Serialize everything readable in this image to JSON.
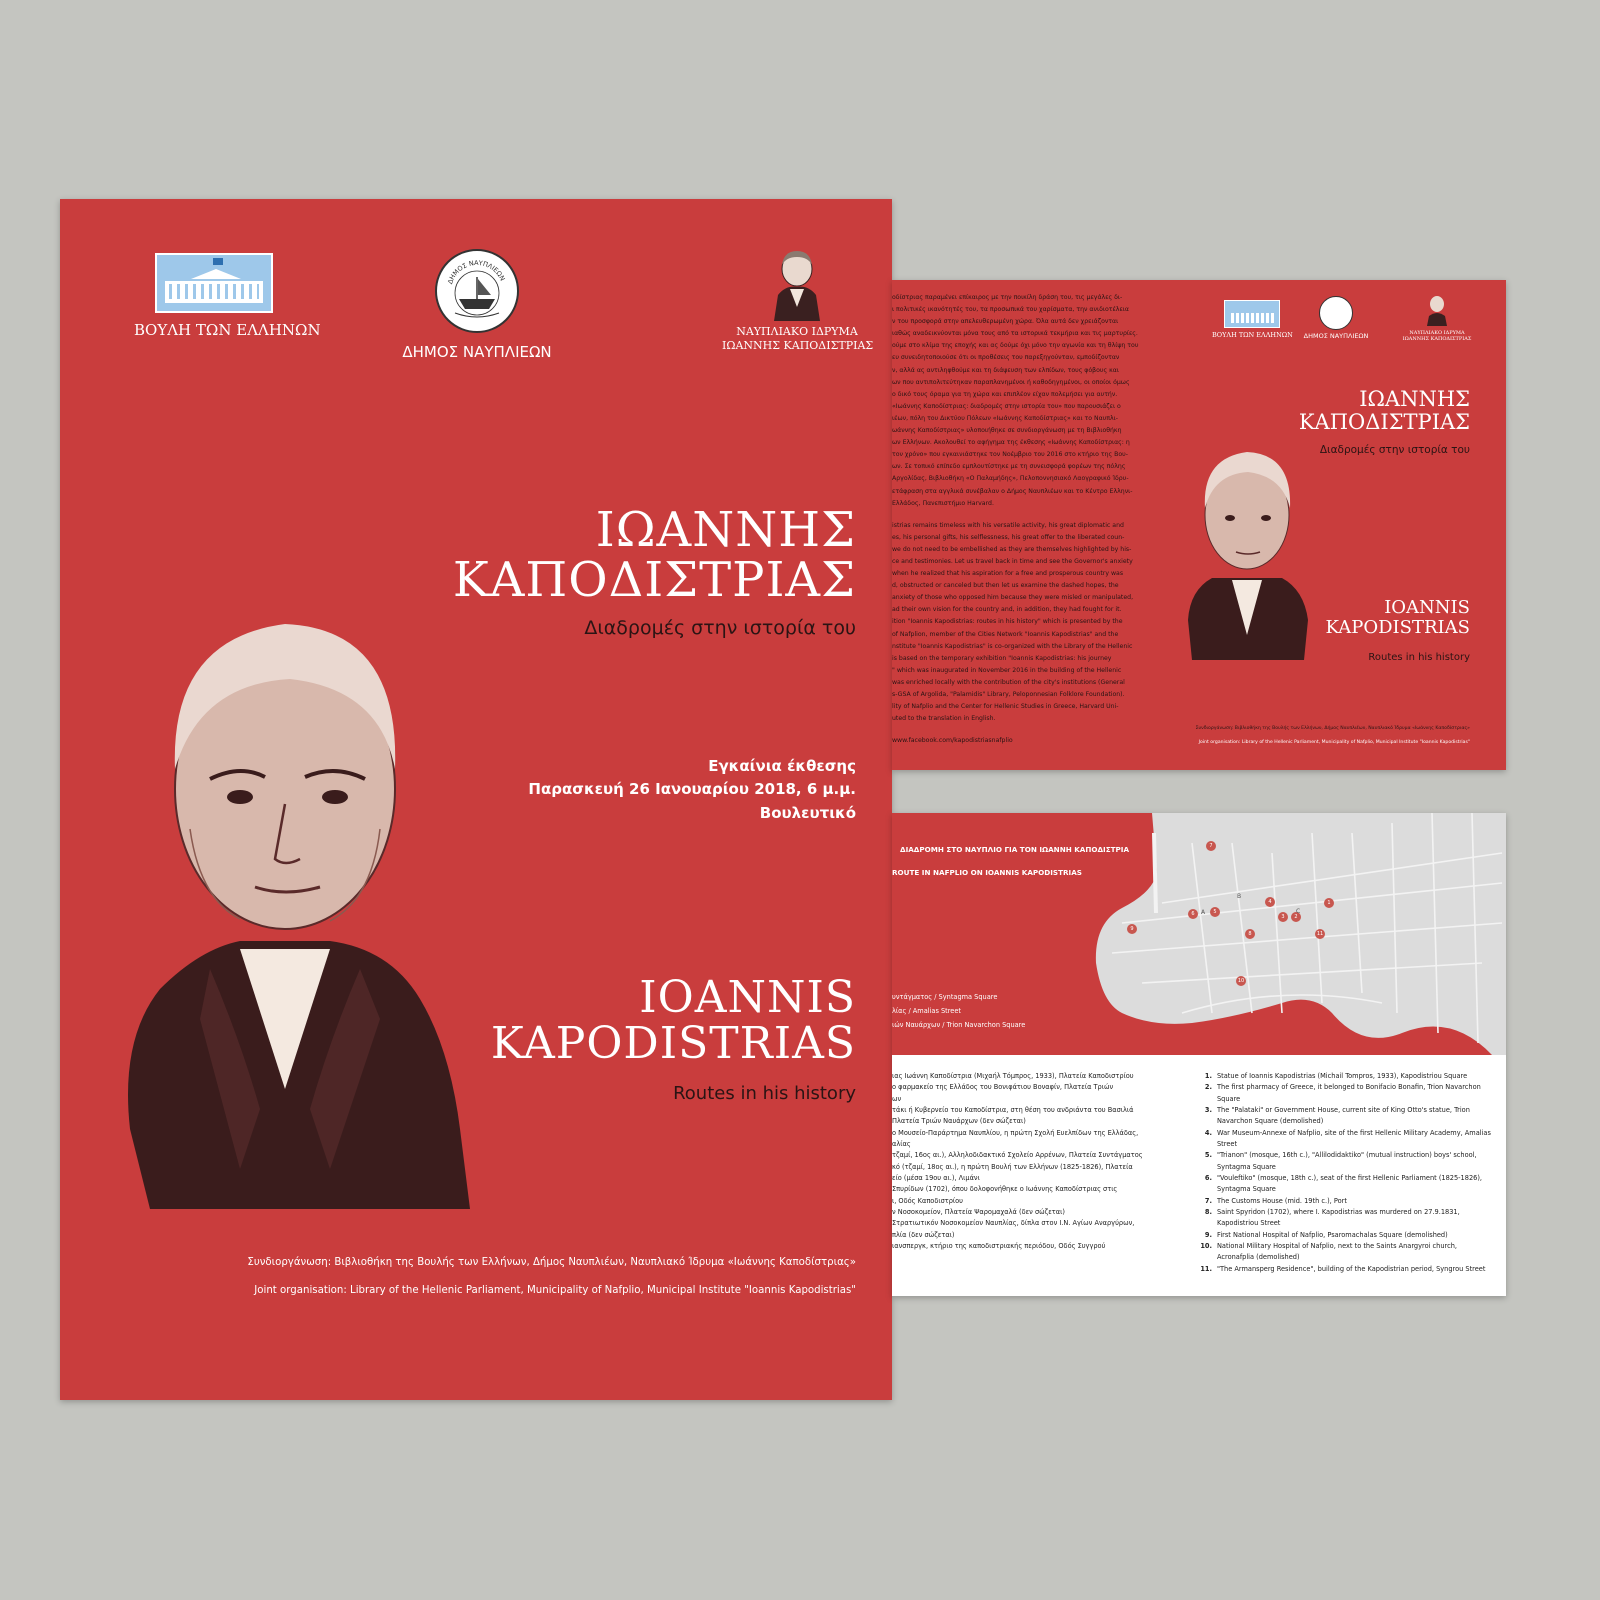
{
  "poster": {
    "logos": {
      "parliament": "ΒΟΥΛΗ ΤΩΝ ΕΛΛΗΝΩΝ",
      "municipality": "ΔΗΜΟΣ ΝΑΥΠΛΙΕΩΝ",
      "municipality_seal": "ΔΗΜΟΣ ΝΑΥΠΛΙΕΩΝ",
      "institute_line1": "ΝΑΥΠΛΙΑΚΟ ΙΔΡΥΜΑ",
      "institute_line2": "ΙΩΑΝΝΗΣ ΚΑΠΟΔΙΣΤΡΙΑΣ"
    },
    "title_gr_line1": "ΙΩΑΝΝΗΣ",
    "title_gr_line2": "ΚΑΠΟΔΙΣΤΡΙΑΣ",
    "subtitle_gr": "Διαδρομές στην ιστορία του",
    "event_line1": "Εγκαίνια έκθεσης",
    "event_line2": "Παρασκευή 26 Ιανουαρίου 2018, 6 μ.μ.",
    "event_line3": "Βουλευτικό",
    "title_en_line1": "IOANNIS",
    "title_en_line2": "KAPODISTRIAS",
    "subtitle_en": "Routes in his history",
    "credit_gr": "Συνδιοργάνωση: Βιβλιοθήκη της Βουλής των Ελλήνων, Δήμος Ναυπλιέων, Ναυπλιακό Ίδρυμα «Ιωάννης Καποδίστριας»",
    "credit_en": "Joint organisation: Library of the Hellenic Parliament, Municipality of Nafplio, Municipal Institute \"Ioannis Kapodistrias\""
  },
  "brochure_top": {
    "text_gr": [
      "οδίστριας παραμένει επίκαιρος με την ποικίλη δράση του, τις μεγάλες δι-",
      "ι πολιτικές ικανότητές του, τα προσωπικά του χαρίσματα, την ανιδιοτέλεια",
      "ν του προσφορά στην απελευθερωμένη χώρα. Όλα αυτά δεν χρειάζονται",
      "ιαθώς αναδεικνύονται μόνα τους από τα ιστορικά τεκμήρια και τις μαρτυρίες.",
      "ούμε στο κλίμα της εποχής και ας δούμε όχι μόνο την αγωνία και τη θλίψη του",
      "ευ συνειδητοποιούσε ότι οι προθέσεις του παρεξηγούνταν, εμποδίζονταν",
      "ν, αλλά ας αντιληφθούμε και τη διάψευση των ελπίδων, τους φόβους και",
      "ων που αντιπολιτεύτηκαν παραπλανημένοι ή καθοδηγημένοι, οι οποίοι όμως",
      "ο δικό τους όραμα για τη χώρα και επιπλέον είχαν πολεμήσει για αυτήν.",
      "«Ιωάννης Καποδίστριας: διαδρομές στην ιστορία του» που παρουσιάζει ο",
      "ιέων, πόλη του Δικτύου Πόλεων «Ιωάννης Καποδίστριας» και το Ναυπλι-",
      "ωάννης Καποδίστριας» υλοποιήθηκε σε συνδιοργάνωση με τη  Βιβλιοθήκη",
      "ων Ελλήνων. Ακολουθεί το αφήγημα της έκθεσης «Ιωάννης Καποδίστριας: η",
      "τον χρόνο» που εγκαινιάστηκε τον Νοέμβριο του 2016 στο κτήριο της Βου-",
      "ων. Σε τοπικό επίπεδο εμπλουτίστηκε με τη συνεισφορά φορέων της πόλης",
      "Αργολίδας, Βιβλιοθήκη «Ο Παλαμήδης», Πελοποννησιακό Λαογραφικό Ίδρυ-",
      "ετάφραση στα αγγλικά συνέβαλαν ο Δήμος Ναυπλιέων και το Κέντρο Ελληνι-",
      "Ελλάδος, Πανεπιστήμιο Harvard."
    ],
    "text_en": [
      "istrias remains timeless with his versatile activity, his great diplomatic and",
      "es, his personal gifts, his selflessness, his great offer to the liberated coun-",
      "we do not need to be embellished as they are themselves highlighted by his-",
      "ce and testimonies. Let us travel back in time and see the Governor's anxiety",
      "when he realized that his aspiration for a free and prosperous country was",
      "d, obstructed or canceled but then let us examine the dashed hopes, the",
      "anxiety of those who opposed him because they were misled or manipulated,",
      "ad their own vision for the country and, in addition, they had fought for it.",
      "ition \"Ioannis Kapodistrias: routes in his history\" which is presented by the",
      "of Nafplion, member of the Cities Network \"Ioannis Kapodistrias\" and the",
      "nstitute \"Ioannis Kapodistrias\" is co-organized with the Library of the Hellenic",
      "is based on the temporary exhibition \"Ioannis Kapodistrias: his journey",
      "\" which was inaugurated in November 2016 in the building of the Hellenic",
      "was enriched locally with the contribution of the city's institutions (General",
      "s-GSA of Argolida, \"Palamidis\" Library, Peloponnesian Folklore Foundation).",
      "lity of Nafplio and the Center for Hellenic Studies in Greece, Harvard Uni-",
      "uted to the translation in English."
    ],
    "facebook": "www.facebook.com/kapodistriasnafplio",
    "logos": {
      "parliament": "ΒΟΥΛΗ ΤΩΝ ΕΛΛΗΝΩΝ",
      "municipality": "ΔΗΜΟΣ ΝΑΥΠΛΙΕΩΝ",
      "institute_line1": "ΝΑΥΠΛΙΑΚΟ ΙΔΡΥΜΑ",
      "institute_line2": "ΙΩΑΝΝΗΣ ΚΑΠΟΔΙΣΤΡΙΑΣ"
    },
    "title_gr_line1": "ΙΩΑΝΝΗΣ",
    "title_gr_line2": "ΚΑΠΟΔΙΣΤΡΙΑΣ",
    "subtitle_gr": "Διαδρομές στην ιστορία του",
    "title_en_line1": "IOANNIS",
    "title_en_line2": "KAPODISTRIAS",
    "subtitle_en": "Routes in his history",
    "credit_gr": "Συνδιοργάνωση: Βιβλιοθήκη της Βουλής των Ελλήνων, Δήμος Ναυπλιέων, Ναυπλιακό Ίδρυμα «Ιωάννης Καποδίστριας»",
    "credit_en": "Joint organisation: Library of the Hellenic Parliament, Municipality of Nafplio, Municipal Institute \"Ioannis Kapodistrias\""
  },
  "brochure_bottom": {
    "route_title_gr": "ΔΙΑΔΡΟΜΗ ΣΤΟ ΝΑΥΠΛΙΟ ΓΙΑ ΤΟΝ ΙΩΑΝΝΗ ΚΑΠΟΔΙΣΤΡΙΑ",
    "route_title_en": "ROUTE IN  NAFPLIO ON IOANNIS KAPODISTRIAS",
    "map_legend": [
      "υντάγματος / Syntagma Square",
      "λίας / Amalias Street",
      "ιών Ναυάρχων / Trion Navarchon Square"
    ],
    "map_markers": [
      "1",
      "2",
      "3",
      "4",
      "5",
      "6",
      "7",
      "8",
      "9",
      "10",
      "11"
    ],
    "map_letters": [
      "A",
      "B",
      "C"
    ],
    "list_gr": [
      "ιας Ιωάννη Καποδίστρια (Μιχαήλ Τόμπρος, 1933), Πλατεία Καποδιστρίου",
      "ο φαρμακείο της Ελλάδος του Βονιφάτιου Βοναφίν, Πλατεία Τριών",
      "ων",
      "τάκι ή Κυβερνείο του Καποδίστρια, στη θέση του ανδριάντα του Βασιλιά",
      "Πλατεία Τριών Ναυάρχων (δεν σώζεται)",
      "ο Μουσείο-Παράρτημα Ναυπλίου, η πρώτη Σχολή Ευελπίδων της Ελλάδας,",
      "αλίας",
      "τζαμί, 16ος αι.), Αλληλοδιδακτικό Σχολείο Αρρένων, Πλατεία Συντάγματος",
      "κό (τζαμί, 18ος αι.), η πρώτη Βουλή των Ελλήνων (1825-1826), Πλατεία",
      "",
      "είο (μέσα 19ου αι.), Λιμάνι",
      "Σπυρίδων (1702), όπου δολοφονήθηκε ο Ιωάννης Καποδίστριας στις",
      "ι, Οδός Καποδιστρίου",
      "ν Νοσοκομείον, Πλατεία Ψαρομαχαλά (δεν σώζεται)",
      "Στρατιωτικόν Νοσοκομείον Ναυπλίας, δίπλα στον Ι.Ν. Αγίων Αναργύρων,",
      "πλία (δεν σώζεται)",
      "ιανσπεργκ, κτήριο της καποδιστριακής περιόδου, Οδός Συγγρού"
    ],
    "list_en": [
      {
        "num": "1.",
        "text": "Statue of Ioannis Kapodistrias (Michail Tompros, 1933), Kapodistriou Square"
      },
      {
        "num": "2.",
        "text": "The first pharmacy of Greece, it belonged to Bonifacio Bonafin, Trion Navarchon"
      },
      {
        "num": "",
        "text": "Square"
      },
      {
        "num": "3.",
        "text": "The \"Palataki\" or Government House, current site of King Otto's statue, Trion"
      },
      {
        "num": "",
        "text": "Navarchon Square (demolished)"
      },
      {
        "num": "4.",
        "text": "War Museum-Annexe of Nafplio, site of the first Hellenic Military Academy, Amalias"
      },
      {
        "num": "",
        "text": "Street"
      },
      {
        "num": "5.",
        "text": "\"Trianon\" (mosque, 16th c.), \"Allilodidaktiko\" (mutual instruction) boys' school,"
      },
      {
        "num": "",
        "text": "Syntagma Square"
      },
      {
        "num": "6.",
        "text": "\"Vouleftiko\" (mosque, 18th c.), seat of the first Hellenic Parliament (1825-1826),"
      },
      {
        "num": "",
        "text": "Syntagma Square"
      },
      {
        "num": "7.",
        "text": "The Customs House (mid. 19th c.), Port"
      },
      {
        "num": "8.",
        "text": "Saint Spyridon (1702), where I. Kapodistrias was murdered on 27.9.1831,"
      },
      {
        "num": "",
        "text": "Kapodistriou Street"
      },
      {
        "num": "9.",
        "text": "First National Hospital of Nafplio, Psaromachalas Square (demolished)"
      },
      {
        "num": "10.",
        "text": "National Military Hospital of Nafplio, next to the Saints Anargyroi church,"
      },
      {
        "num": "",
        "text": "Acronafplia (demolished)"
      },
      {
        "num": "11.",
        "text": "\"The Armansperg Residence\", building of the Kapodistrian period, Syngrou Street"
      }
    ]
  },
  "colors": {
    "background": "#c4c5c0",
    "brand_red": "#c93d3d",
    "parliament_blue": "#9ec8ea",
    "map_grey": "#dcdcdc",
    "marker": "#c8574f"
  }
}
